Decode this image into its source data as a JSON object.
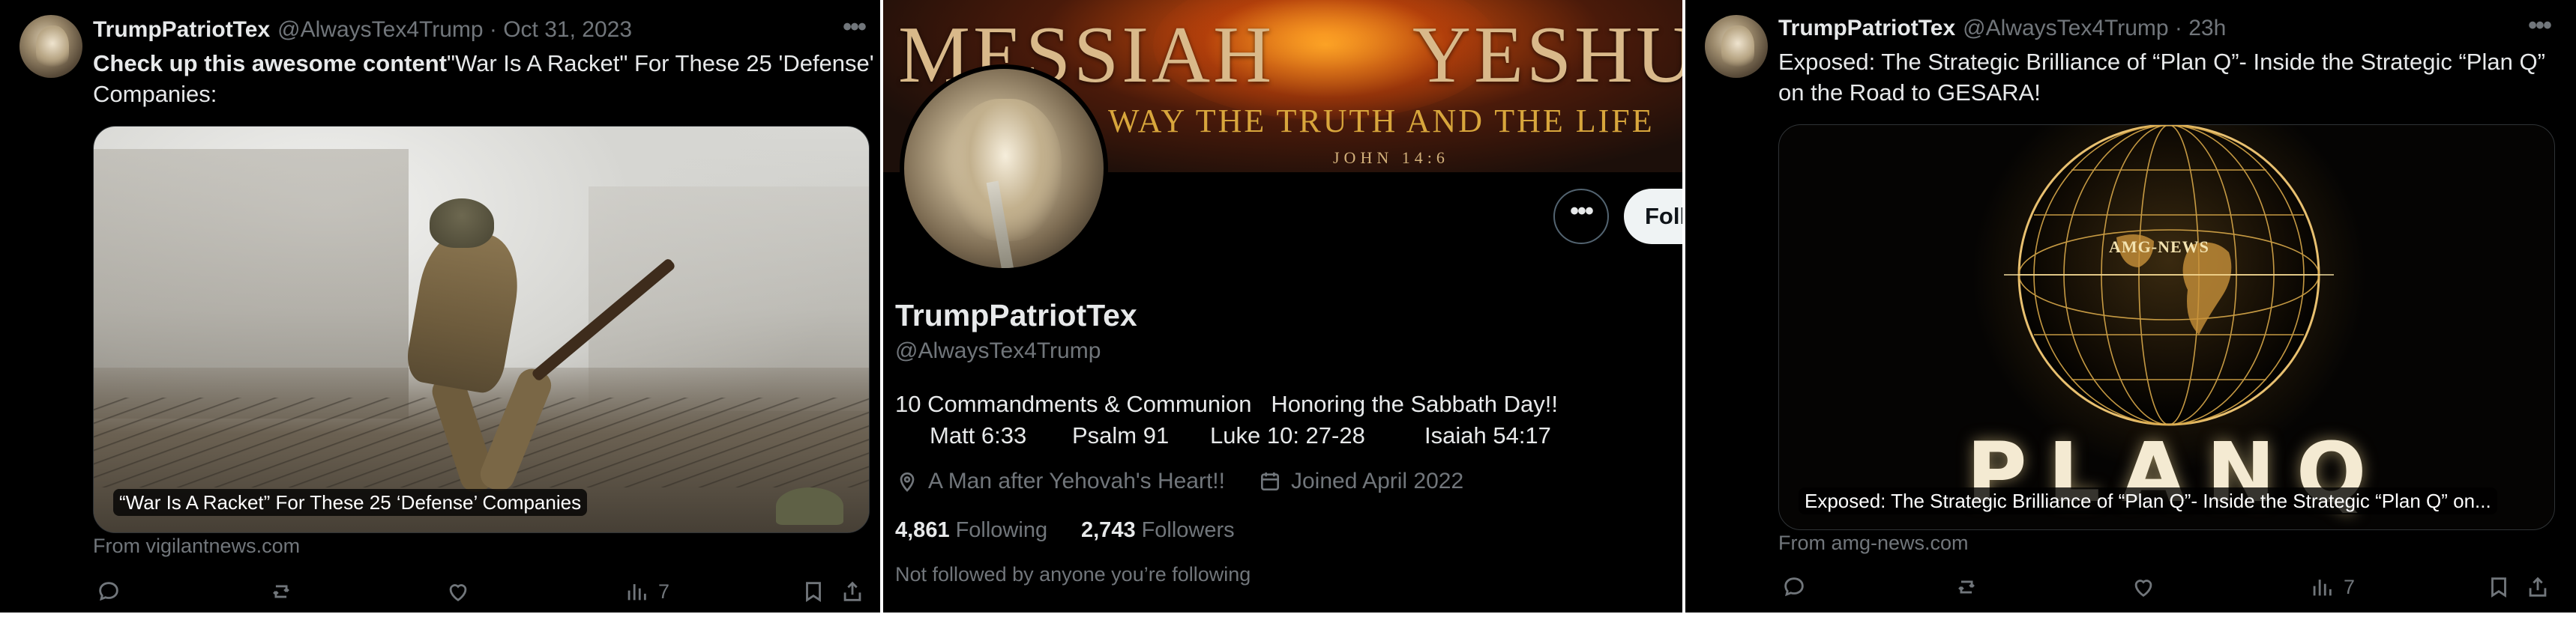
{
  "left_tweet": {
    "display_name": "TrumpPatriotTex",
    "meta": "@AlwaysTex4Trump · Oct 31, 2023",
    "more_icon": "more-horizontal-icon",
    "text_bold": "Check up this awesome content",
    "text_line1_rest": "\"War Is A Racket\" For These 25 'Defense'",
    "text_line2": "Companies:",
    "media_caption": "“War Is A Racket” For These 25 ‘Defense’ Companies",
    "from": "From vigilantnews.com",
    "actions": {
      "reply_icon": "reply-icon",
      "repost_icon": "repost-icon",
      "like_icon": "like-icon",
      "views_icon": "views-icon",
      "views_count": "7",
      "bookmark_icon": "bookmark-icon",
      "share_icon": "share-icon"
    }
  },
  "profile": {
    "banner_title_left": "MESSIAH",
    "banner_title_right": "YESHUA",
    "banner_subtitle": "WAY THE TRUTH AND THE LIFE",
    "banner_verse": "JOHN 14:6",
    "more_button_icon": "more-horizontal-icon",
    "follow_label": "Follow",
    "name": "TrumpPatriotTex",
    "handle": "@AlwaysTex4Trump",
    "bio_line1": "10 Commandments & Communion   Honoring the Sabbath Day!!",
    "bio_verses": [
      "Matt 6:33",
      "Psalm 91",
      "Luke 10: 27-28",
      "Isaiah 54:17"
    ],
    "location_icon": "location-pin-icon",
    "location": "A Man after Yehovah's Heart!!",
    "calendar_icon": "calendar-icon",
    "joined": "Joined April 2022",
    "following_count": "4,861",
    "following_label": "Following",
    "followers_count": "2,743",
    "followers_label": "Followers",
    "not_followed": "Not followed by anyone you’re following"
  },
  "right_tweet": {
    "display_name": "TrumpPatriotTex",
    "meta": "@AlwaysTex4Trump · 23h",
    "more_icon": "more-horizontal-icon",
    "text_line1": "Exposed: The Strategic Brilliance of “Plan Q”- Inside the Strategic “Plan Q”",
    "text_line2": "on the Road to GESARA!",
    "media_logo": "AMG-NEWS",
    "media_big_text": "PLANQ",
    "media_caption": "Exposed: The Strategic Brilliance of “Plan Q”- Inside the Strategic “Plan Q” on...",
    "from": "From amg-news.com",
    "actions": {
      "reply_icon": "reply-icon",
      "repost_icon": "repost-icon",
      "like_icon": "like-icon",
      "views_icon": "views-icon",
      "views_count": "7",
      "bookmark_icon": "bookmark-icon",
      "share_icon": "share-icon"
    }
  }
}
